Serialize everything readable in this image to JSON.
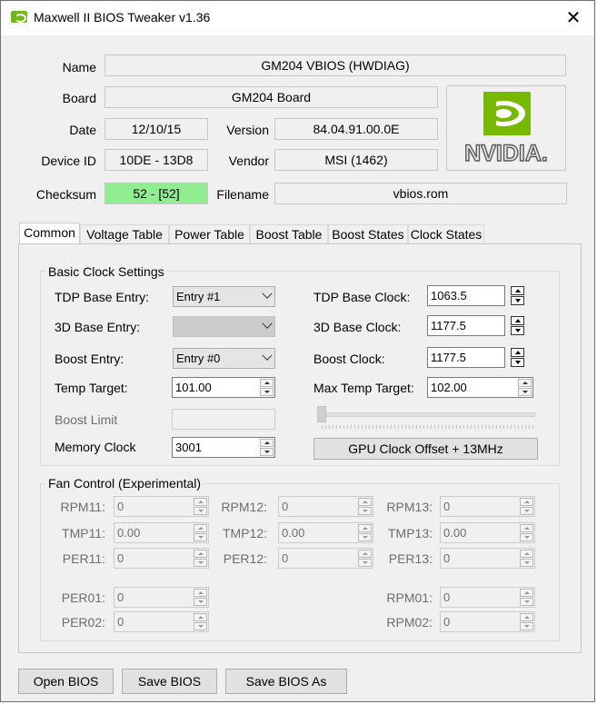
{
  "window": {
    "title": "Maxwell II BIOS Tweaker v1.36",
    "close_glyph": "✕"
  },
  "info": {
    "name_label": "Name",
    "name_value": "GM204 VBIOS (HWDIAG)",
    "board_label": "Board",
    "board_value": "GM204 Board",
    "date_label": "Date",
    "date_value": "12/10/15",
    "version_label": "Version",
    "version_value": "84.04.91.00.0E",
    "device_label": "Device ID",
    "device_value": "10DE - 13D8",
    "vendor_label": "Vendor",
    "vendor_value": "MSI (1462)",
    "checksum_label": "Checksum",
    "checksum_value": "52 - [52]",
    "filename_label": "Filename",
    "filename_value": "vbios.rom",
    "checksum_color": "#90ee90"
  },
  "logo": {
    "text": "NVIDIA.",
    "icon": "nvidia-eye-logo",
    "color": "#76b900"
  },
  "tabs": [
    "Common",
    "Voltage Table",
    "Power Table",
    "Boost Table",
    "Boost States",
    "Clock States"
  ],
  "basic": {
    "title": "Basic Clock Settings",
    "tdp_base_entry_label": "TDP Base Entry:",
    "tdp_base_entry_value": "Entry #1",
    "base3d_entry_label": "3D Base Entry:",
    "base3d_entry_value": "",
    "boost_entry_label": "Boost Entry:",
    "boost_entry_value": "Entry #0",
    "temp_target_label": "Temp Target:",
    "temp_target_value": "101.00",
    "boost_limit_label": "Boost Limit",
    "boost_limit_value": "",
    "memory_clock_label": "Memory Clock",
    "memory_clock_value": "3001",
    "tdp_base_clock_label": "TDP Base Clock:",
    "tdp_base_clock_value": "1063.5",
    "base3d_clock_label": "3D Base Clock:",
    "base3d_clock_value": "1177.5",
    "boost_clock_label": "Boost Clock:",
    "boost_clock_value": "1177.5",
    "max_temp_label": "Max Temp Target:",
    "max_temp_value": "102.00",
    "offset_button": "GPU Clock Offset + 13MHz",
    "offset_slider_level": 0
  },
  "fan": {
    "title": "Fan Control (Experimental)",
    "rpm11_label": "RPM11:",
    "rpm11_value": "0",
    "rpm12_label": "RPM12:",
    "rpm12_value": "0",
    "rpm13_label": "RPM13:",
    "rpm13_value": "0",
    "tmp11_label": "TMP11:",
    "tmp11_value": "0.00",
    "tmp12_label": "TMP12:",
    "tmp12_value": "0.00",
    "tmp13_label": "TMP13:",
    "tmp13_value": "0.00",
    "per11_label": "PER11:",
    "per11_value": "0",
    "per12_label": "PER12:",
    "per12_value": "0",
    "per13_label": "PER13:",
    "per13_value": "0",
    "per01_label": "PER01:",
    "per01_value": "0",
    "per02_label": "PER02:",
    "per02_value": "0",
    "rpm01_label": "RPM01:",
    "rpm01_value": "0",
    "rpm02_label": "RPM02:",
    "rpm02_value": "0"
  },
  "buttons": {
    "open": "Open BIOS",
    "save": "Save BIOS",
    "save_as": "Save BIOS As"
  }
}
